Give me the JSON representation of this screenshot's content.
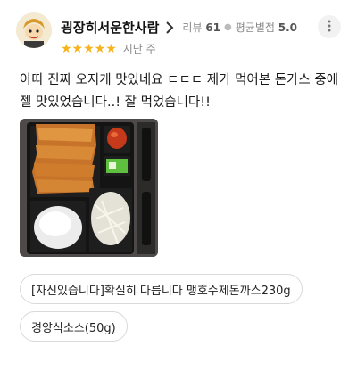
{
  "review": {
    "username": "굉장히서운한사람",
    "review_label": "리뷰",
    "review_count": "61",
    "avg_label": "평균별점",
    "avg_rating": "5.0",
    "stars": "★★★★★",
    "rating": 5,
    "date": "지난 주",
    "text": "아따 진짜 오지게 맛있네요 ㄷㄷㄷ 제가 먹어본 돈가스 중에 젤 맛있었습니다..! 잘 먹었습니다!!",
    "menu_items": [
      "[자신있습니다]확실히 다릅니다 맹호수제돈까스230g",
      "경양식소스(50g)"
    ]
  },
  "icons": {
    "avatar": "cartoon-character-avatar",
    "chevron": "chevron-right-icon",
    "more": "more-vertical-icon",
    "star_color": "#f6b31b"
  }
}
